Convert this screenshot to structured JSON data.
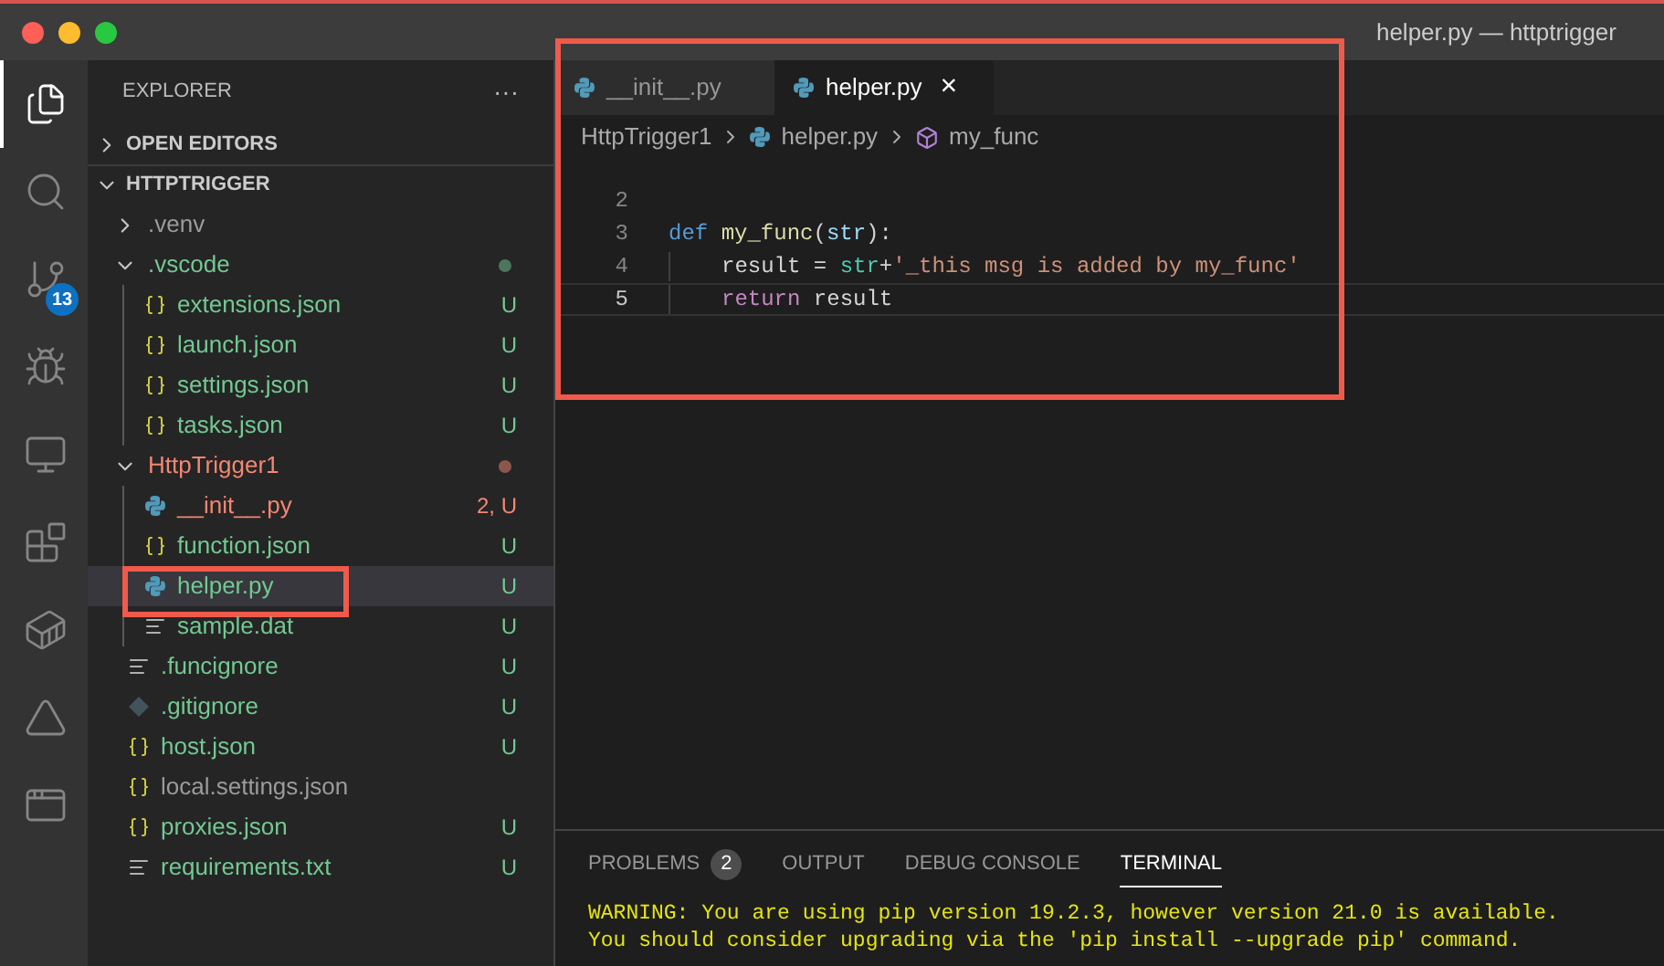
{
  "window": {
    "title": "helper.py — httptrigger"
  },
  "activity_bar": [
    {
      "kind": "explorer",
      "selected": true
    },
    {
      "kind": "search",
      "selected": false
    },
    {
      "kind": "source-control",
      "selected": false,
      "badge": "13"
    },
    {
      "kind": "debug",
      "selected": false
    },
    {
      "kind": "remote",
      "selected": false
    },
    {
      "kind": "extensions",
      "selected": false
    },
    {
      "kind": "docker",
      "selected": false
    },
    {
      "kind": "azure",
      "selected": false
    },
    {
      "kind": "panel",
      "selected": false
    }
  ],
  "sidebar": {
    "title": "EXPLORER",
    "more": "···",
    "sections": [
      {
        "label": "OPEN EDITORS",
        "expanded": false
      },
      {
        "label": "HTTPTRIGGER",
        "expanded": true
      }
    ],
    "tree": [
      {
        "name": ".venv",
        "kind": "folder",
        "expanded": false,
        "color": "#9b9b9b",
        "selected": false
      },
      {
        "name": ".vscode",
        "kind": "folder",
        "expanded": true,
        "color": "#73c991",
        "has_changes": true,
        "selected": false,
        "children": [
          {
            "name": "extensions.json",
            "kind": "json",
            "color": "#73c991",
            "badge": "U",
            "selected": false
          },
          {
            "name": "launch.json",
            "kind": "json",
            "color": "#73c991",
            "badge": "U",
            "selected": false
          },
          {
            "name": "settings.json",
            "kind": "json",
            "color": "#73c991",
            "badge": "U",
            "selected": false
          },
          {
            "name": "tasks.json",
            "kind": "json",
            "color": "#73c991",
            "badge": "U",
            "selected": false
          }
        ]
      },
      {
        "name": "HttpTrigger1",
        "kind": "folder",
        "expanded": true,
        "color": "#f48771",
        "has_changes": true,
        "selected": false,
        "children": [
          {
            "name": "__init__.py",
            "kind": "python",
            "color": "#f48771",
            "badge": "2, U",
            "selected": false
          },
          {
            "name": "function.json",
            "kind": "json",
            "color": "#73c991",
            "badge": "U",
            "selected": false
          },
          {
            "name": "helper.py",
            "kind": "python",
            "color": "#73c991",
            "badge": "U",
            "selected": true
          },
          {
            "name": "sample.dat",
            "kind": "text",
            "color": "#73c991",
            "badge": "U",
            "selected": false
          }
        ]
      },
      {
        "name": ".funcignore",
        "kind": "text",
        "color": "#73c991",
        "badge": "U",
        "selected": false
      },
      {
        "name": ".gitignore",
        "kind": "git",
        "color": "#73c991",
        "badge": "U",
        "selected": false
      },
      {
        "name": "host.json",
        "kind": "json",
        "color": "#73c991",
        "badge": "U",
        "selected": false
      },
      {
        "name": "local.settings.json",
        "kind": "json",
        "color": "#9b9b9b",
        "selected": false
      },
      {
        "name": "proxies.json",
        "kind": "json",
        "color": "#73c991",
        "badge": "U",
        "selected": false
      },
      {
        "name": "requirements.txt",
        "kind": "text",
        "color": "#73c991",
        "badge": "U",
        "selected": false
      }
    ]
  },
  "editor": {
    "tabs": [
      {
        "label": "__init__.py",
        "selected": false
      },
      {
        "label": "helper.py",
        "selected": true,
        "close": "×"
      }
    ],
    "breadcrumbs": [
      {
        "label": "HttpTrigger1",
        "kind": "folder"
      },
      {
        "label": "helper.py",
        "kind": "python"
      },
      {
        "label": "my_func",
        "kind": "symbol"
      }
    ],
    "lines": [
      {
        "number": "2",
        "current": false,
        "indented": false
      },
      {
        "number": "3",
        "current": false,
        "indented": false,
        "tokens": [
          {
            "kind": "keyword",
            "text": "def "
          },
          {
            "kind": "function",
            "text": "my_func"
          },
          {
            "kind": "plain",
            "text": "("
          },
          {
            "kind": "param",
            "text": "str"
          },
          {
            "kind": "plain",
            "text": "):"
          }
        ]
      },
      {
        "number": "4",
        "current": false,
        "indented": true,
        "tokens": [
          {
            "kind": "plain",
            "text": "result = "
          },
          {
            "kind": "builtin",
            "text": "str"
          },
          {
            "kind": "plain",
            "text": "+"
          },
          {
            "kind": "string",
            "text": "'_this msg is added by my_func'"
          }
        ]
      },
      {
        "number": "5",
        "current": true,
        "indented": true,
        "tokens": [
          {
            "kind": "control",
            "text": "return"
          },
          {
            "kind": "plain",
            "text": " result"
          }
        ]
      }
    ]
  },
  "panel": {
    "tabs": [
      {
        "label": "PROBLEMS",
        "badge": "2",
        "selected": false
      },
      {
        "label": "OUTPUT",
        "selected": false
      },
      {
        "label": "DEBUG CONSOLE",
        "selected": false
      },
      {
        "label": "TERMINAL",
        "selected": true
      }
    ],
    "terminal": [
      "WARNING: You are using pip version 19.2.3, however version 21.0 is available.",
      "You should consider upgrading via the 'pip install --upgrade pip' command."
    ]
  }
}
